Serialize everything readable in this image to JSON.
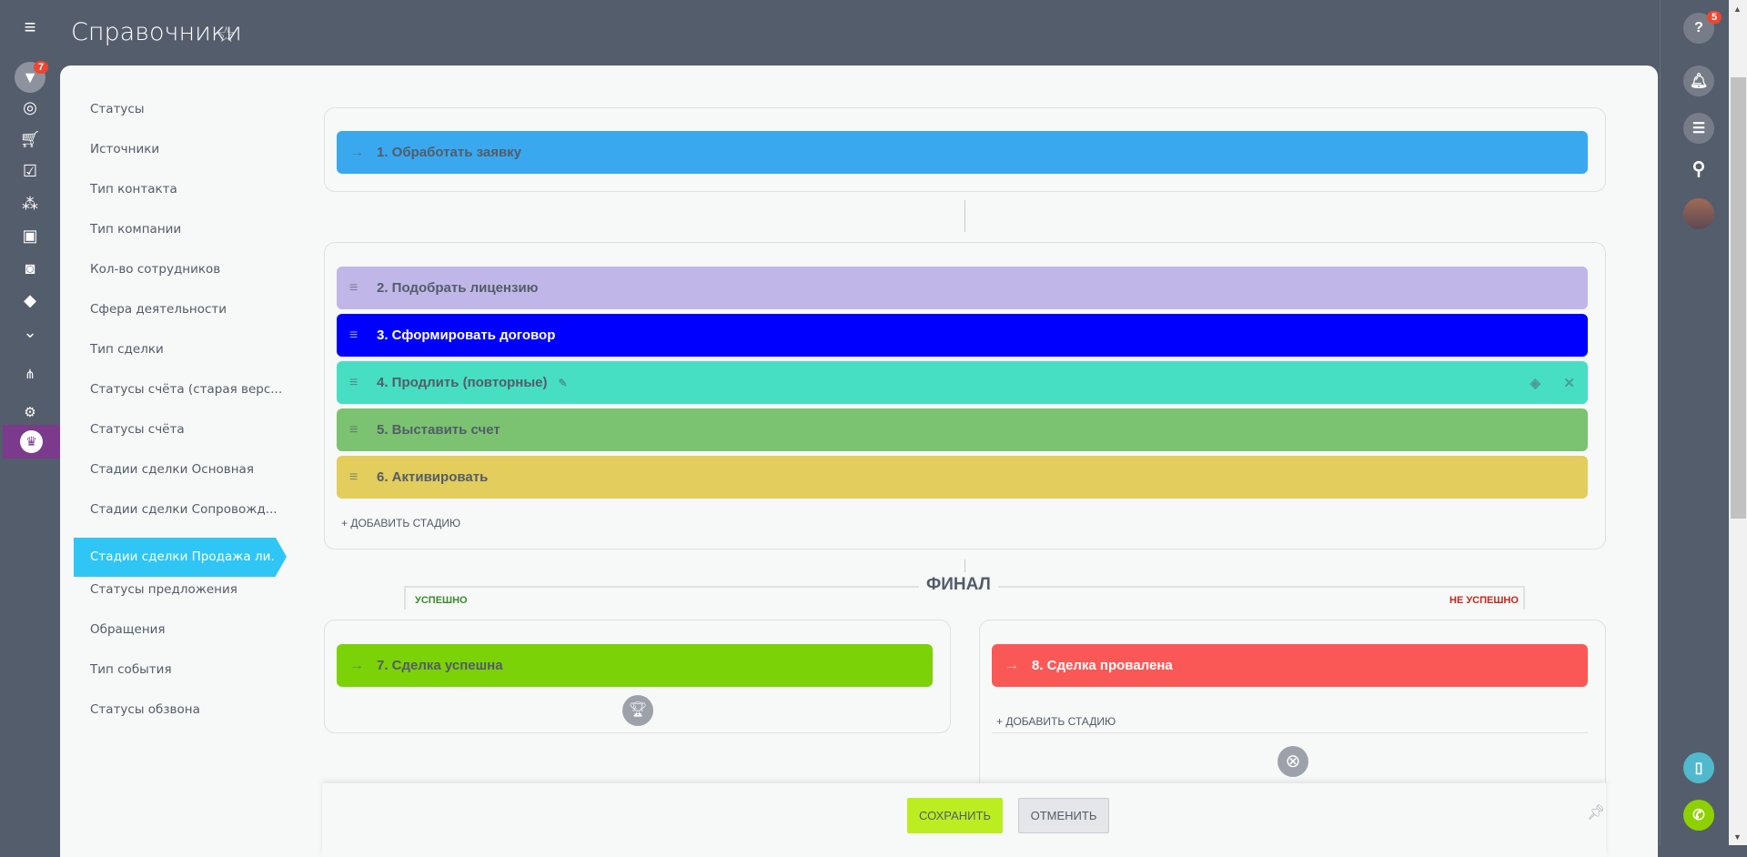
{
  "header": {
    "title": "Справочники"
  },
  "leftnav": {
    "badge": "7"
  },
  "rightbar": {
    "help_badge": "5"
  },
  "sidebar": {
    "items": [
      "Статусы",
      "Источники",
      "Тип контакта",
      "Тип компании",
      "Кол-во сотрудников",
      "Сфера деятельности",
      "Тип сделки",
      "Статусы счёта (старая верс...",
      "Статусы счёта",
      "Стадии сделки Основная",
      "Стадии сделки Сопровожд...",
      "Стадии сделки Продажа ли...",
      "Статусы предложения",
      "Обращения",
      "Тип события",
      "Статусы обзвона"
    ],
    "active_index": 11
  },
  "stages": {
    "first": {
      "label": "1. Обработать заявку",
      "color": "#39a8ef"
    },
    "middle": [
      {
        "label": "2. Подобрать лицензию",
        "color": "#c0b7e8",
        "text": "#535c69"
      },
      {
        "label": "3. Сформировать договор",
        "color": "#0000ff",
        "text": "#ffffff"
      },
      {
        "label": "4. Продлить (повторные)",
        "color": "#47dfc3",
        "text": "#535c69"
      },
      {
        "label": "5. Выставить счет",
        "color": "#7bc271",
        "text": "#535c69"
      },
      {
        "label": "6. Активировать",
        "color": "#e2cd5d",
        "text": "#535c69"
      }
    ],
    "add_stage": "ДОБАВИТЬ СТАДИЮ",
    "final_title": "ФИНАЛ",
    "success_label": "УСПЕШНО",
    "fail_label": "НЕ УСПЕШНО",
    "success": {
      "label": "7. Сделка успешна",
      "color": "#7bd207"
    },
    "fail": {
      "label": "8. Сделка провалена",
      "color": "#fa5856"
    }
  },
  "footer": {
    "save": "СОХРАНИТЬ",
    "cancel": "ОТМЕНИТЬ"
  }
}
